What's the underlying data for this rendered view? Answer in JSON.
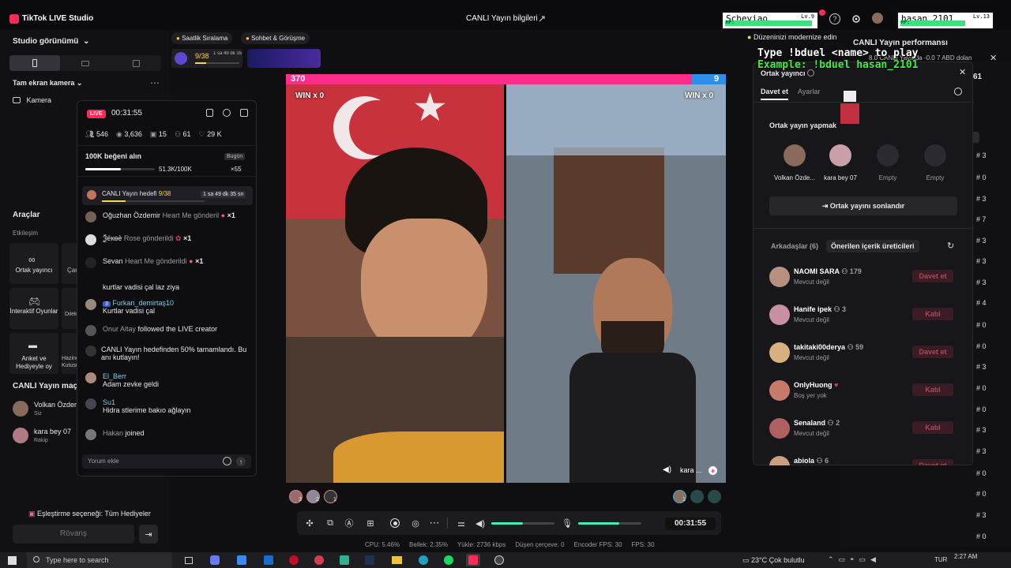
{
  "app": {
    "title": "TikTok LIVE Studio",
    "live_info_title": "CANLI Yayın bilgileri"
  },
  "top_overlays": {
    "player1": {
      "name": "Scheviao",
      "level": "Lv.9",
      "hp_label": "HP:"
    },
    "player2": {
      "name": "hasan_2101",
      "level": "Lv.13",
      "hp_label": "HP:"
    },
    "game_line1": "Type !bduel <name> to play",
    "game_line2": "Example: !bduel hasan_2101",
    "modernize": "Düzeninizi modernize edin",
    "perf_title": "CANLI Yayın performansı",
    "perf_sub": "8.0 CANLI Yayında -0.0 7 ABD dolan",
    "perf_num": "61"
  },
  "left": {
    "studio_view": "Studio görünümü",
    "fullscreen_camera": "Tam ekran kamera",
    "camera": "Kamera",
    "tools": "Araçlar",
    "interaction": "Etkileşim",
    "tool_cohost": "Ortak yayıncı",
    "tool_interactive": "İnteraktif Oyunlar",
    "tool_poll": "Anket ve Hediyeyle oy",
    "tool_treasure": "Hazine Kutusu",
    "tool_clipped1": "Çarkı",
    "tool_clipped2": "Dileklerin",
    "matches_title": "CANLI Yayın maçı",
    "match1_name": "Volkan Özdemir",
    "match1_role": "Siz",
    "match2_name": "kara bey 07",
    "match2_role": "Rakip",
    "pairing": "Eşleştirme seçeneği: Tüm Hediyeler",
    "rematch": "Rövanş"
  },
  "chat": {
    "live_badge": "LIVE",
    "timer": "00:31:55",
    "stats": [
      "546",
      "3,636",
      "15",
      "61",
      "29 K"
    ],
    "goal_title": "100K beğeni alın",
    "goal_today": "Bugün",
    "goal_progress": "51.3K/100K",
    "goal_multiplier": "×55",
    "goal_progress_fraction": 0.51,
    "stream_goal": "CANLI Yayın hedefi",
    "stream_goal_count": "9/38",
    "stream_goal_time": "1 sa 49 dk 35 sn",
    "messages": [
      {
        "user": "Oğuzhan Özdemir",
        "text": "Heart Me gönderil",
        "suffix": "×1"
      },
      {
        "user": "Ѯёкѳѐ",
        "text": "Rose gönderildi",
        "suffix": "×1"
      },
      {
        "user": "Sevan",
        "text": "Heart Me gönderildi",
        "suffix": "×1"
      },
      {
        "user": "",
        "text": "kurtlar vadisi çal laz ziya",
        "suffix": ""
      },
      {
        "user": "Furkan_demirtaş10",
        "text": "Kurtlar vadisi çal",
        "suffix": ""
      },
      {
        "user": "Onur Altay",
        "text": "followed the LIVE creator",
        "suffix": ""
      },
      {
        "user": "",
        "text": "CANLI Yayın hedefinden 50% tamamlandı. Bu anı kutlayın!",
        "suffix": ""
      },
      {
        "user": "El_Berr",
        "text": "Adam zevke geldi",
        "suffix": ""
      },
      {
        "user": "Su1",
        "text": "Hidra stlerime bakıo ağlayın",
        "suffix": ""
      },
      {
        "user": "Hakan",
        "text": "joined",
        "suffix": ""
      }
    ],
    "badge_num": "3",
    "input_placeholder": "Yorum ekle"
  },
  "top_pills": {
    "ranking": "Saatlik Sıralama",
    "chat_meet": "Sohbet & Görüşme",
    "goal_count": "9/38",
    "goal_time": "1 sa 49 dk 35 sn"
  },
  "battle": {
    "left_score": "370",
    "right_score": "9",
    "left_win": "WIN x 0",
    "right_win": "WIN x 0",
    "right_name": "kara ...",
    "bottom_left_counts": [
      "3",
      "2",
      "1"
    ],
    "bottom_right_counts": [
      "1"
    ]
  },
  "toolbar": {
    "timer": "00:31:55"
  },
  "status_bar": {
    "cpu": "CPU: 5.46%",
    "memory": "Bellek: 2.35%",
    "upload": "Yükle: 2736 kbps",
    "dropped": "Düşen çerçeve: 0",
    "encoder": "Encoder FPS: 30",
    "fps": "FPS: 30"
  },
  "cohost": {
    "title": "Ortak yayıncı",
    "tab_invite": "Davet et",
    "tab_settings": "Ayarlar",
    "section_title": "Ortak yayın yapmak",
    "slots": [
      {
        "name": "Volkan Özde..."
      },
      {
        "name": "kara bey 07"
      },
      {
        "name": "Empty"
      },
      {
        "name": "Empty"
      }
    ],
    "end_button": "Ortak yayını sonlandır",
    "friends_tab": "Arkadaşlar (6)",
    "suggested_tab": "Önerilen içerik üreticileri",
    "friends": [
      {
        "name": "NAOMI SARA",
        "count": "179",
        "status": "Mevcut değil",
        "action": "Davet et"
      },
      {
        "name": "Hanife ipek",
        "count": "3",
        "status": "Mevcut değil",
        "action": "Katıl"
      },
      {
        "name": "takitaki00derya",
        "count": "59",
        "status": "Mevcut değil",
        "action": "Davet et"
      },
      {
        "name": "OnlyHuong",
        "count": "",
        "status": "Boş yer yok",
        "action": "Katıl"
      },
      {
        "name": "Senaland",
        "count": "2",
        "status": "Mevcut değil",
        "action": "Katıl"
      },
      {
        "name": "abiola",
        "count": "6",
        "status": "",
        "action": "Davet et"
      }
    ]
  },
  "right_edge_numbers": [
    "3",
    "0",
    "3",
    "7",
    "3",
    "3",
    "3",
    "4",
    "0",
    "0",
    "3",
    "0",
    "0",
    "3",
    "3",
    "0",
    "0",
    "3",
    "0"
  ],
  "taskbar": {
    "search_placeholder": "Type here to search",
    "weather": "23°C Çok bulutlu",
    "lang": "TUR",
    "time": "2:27 AM"
  }
}
